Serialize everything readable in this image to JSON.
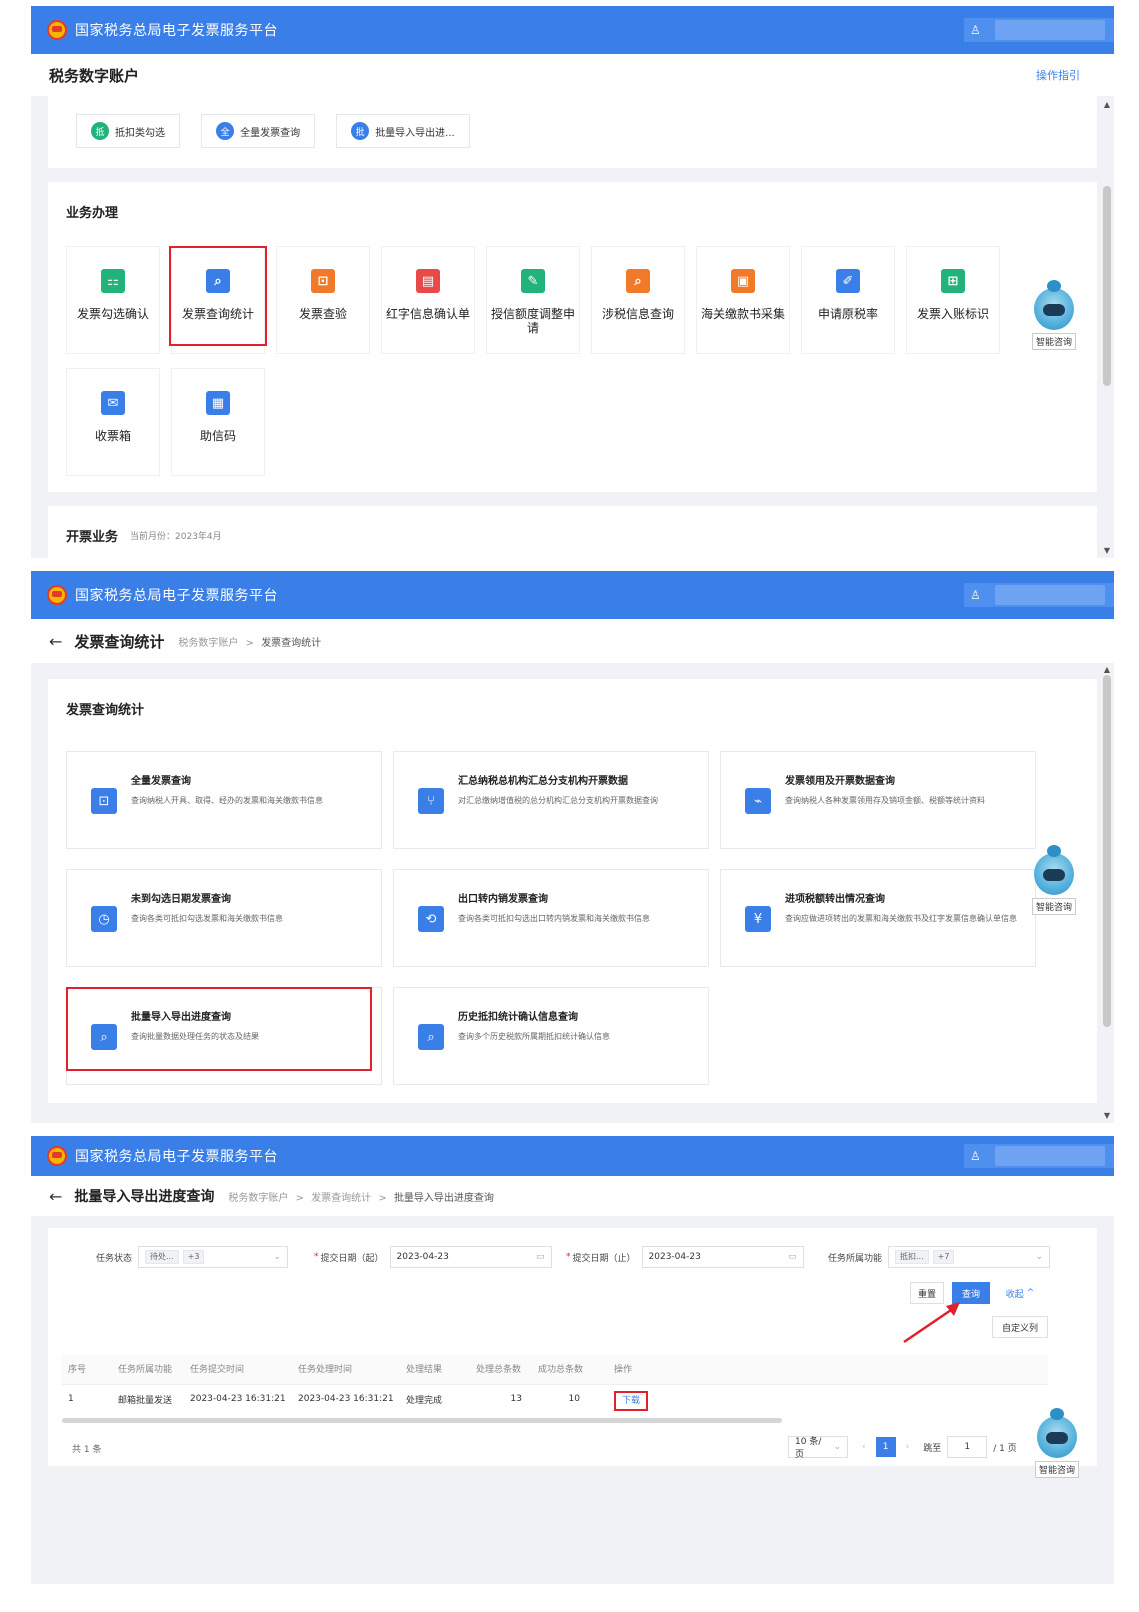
{
  "header": {
    "platform_title": "国家税务总局电子发票服务平台",
    "user_icon": "user-icon"
  },
  "screen1": {
    "page_title": "税务数字账户",
    "guide_link": "操作指引",
    "quick_links": [
      {
        "badge": "抵",
        "label": "抵扣类勾选",
        "color": "#22b37a"
      },
      {
        "badge": "全",
        "label": "全量发票查询",
        "color": "#3a7fe8"
      },
      {
        "badge": "批",
        "label": "批量导入导出进...",
        "color": "#3a7fe8"
      }
    ],
    "section_title": "业务办理",
    "tiles": [
      {
        "label": "发票勾选确认",
        "color": "#22b37a",
        "glyph": "⚏"
      },
      {
        "label": "发票查询统计",
        "color": "#3a7fe8",
        "glyph": "⌕"
      },
      {
        "label": "发票查验",
        "color": "#f07a2a",
        "glyph": "⊡"
      },
      {
        "label": "红字信息确认单",
        "color": "#e84a4a",
        "glyph": "▤"
      },
      {
        "label": "授信额度调整申请",
        "color": "#22b37a",
        "glyph": "✎"
      },
      {
        "label": "涉税信息查询",
        "color": "#f07a2a",
        "glyph": "⌕"
      },
      {
        "label": "海关缴款书采集",
        "color": "#f07a2a",
        "glyph": "▣"
      },
      {
        "label": "申请原税率",
        "color": "#3a7fe8",
        "glyph": "✐"
      },
      {
        "label": "发票入账标识",
        "color": "#22b37a",
        "glyph": "⊞"
      },
      {
        "label": "收票箱",
        "color": "#3a7fe8",
        "glyph": "✉"
      },
      {
        "label": "助信码",
        "color": "#3a7fe8",
        "glyph": "▦"
      }
    ],
    "billing_title": "开票业务",
    "billing_month": "当前月份：2023年4月",
    "assistant_label": "智能咨询"
  },
  "screen2": {
    "page_title": "发票查询统计",
    "breadcrumb_root": "税务数字账户",
    "breadcrumb_sep": ">",
    "breadcrumb_current": "发票查询统计",
    "section_title": "发票查询统计",
    "cards": [
      {
        "title": "全量发票查询",
        "desc": "查询纳税人开具、取得、经办的发票和海关缴款书信息",
        "glyph": "⊡"
      },
      {
        "title": "汇总纳税总机构汇总分支机构开票数据",
        "desc": "对汇总缴纳增值税的总分机构汇总分支机构开票数据查询",
        "glyph": "⑂"
      },
      {
        "title": "发票领用及开票数据查询",
        "desc": "查询纳税人各种发票领用存及销项金额、税额等统计资料",
        "glyph": "⌁"
      },
      {
        "title": "未到勾选日期发票查询",
        "desc": "查询各类可抵扣勾选发票和海关缴款书信息",
        "glyph": "◷"
      },
      {
        "title": "出口转内销发票查询",
        "desc": "查询各类可抵扣勾选出口转内销发票和海关缴款书信息",
        "glyph": "⟲"
      },
      {
        "title": "进项税额转出情况查询",
        "desc": "查询应做进项转出的发票和海关缴款书及红字发票信息确认单信息",
        "glyph": "¥"
      },
      {
        "title": "批量导入导出进度查询",
        "desc": "查询批量数据处理任务的状态及结果",
        "glyph": "⌕"
      },
      {
        "title": "历史抵扣统计确认信息查询",
        "desc": "查询多个历史税款所属期抵扣统计确认信息",
        "glyph": "⌕"
      }
    ],
    "assistant_label": "智能咨询"
  },
  "screen3": {
    "page_title": "批量导入导出进度查询",
    "breadcrumb": [
      "税务数字账户",
      "发票查询统计",
      "批量导入导出进度查询"
    ],
    "breadcrumb_sep": ">",
    "filters": {
      "status_label": "任务状态",
      "status_chip": "待处...",
      "status_more": "+3",
      "start_label": "提交日期（起）",
      "start_value": "2023-04-23",
      "end_label": "提交日期（止）",
      "end_value": "2023-04-23",
      "func_label": "任务所属功能",
      "func_chip": "抵扣...",
      "func_more": "+7"
    },
    "buttons": {
      "reset": "重置",
      "query": "查询",
      "collapse": "收起",
      "custom_columns": "自定义列"
    },
    "table": {
      "headers": [
        "序号",
        "任务所属功能",
        "任务提交时间",
        "任务处理时间",
        "处理结果",
        "处理总条数",
        "成功总条数",
        "操作"
      ],
      "rows": [
        [
          "1",
          "邮箱批量发送",
          "2023-04-23 16:31:21",
          "2023-04-23 16:31:21",
          "处理完成",
          "13",
          "10",
          "下载"
        ]
      ]
    },
    "pagination": {
      "total": "共 1 条",
      "page_size": "10 条/页",
      "current_page": "1",
      "jump_label": "跳至",
      "jump_value": "1",
      "page_suffix": "/ 1 页"
    },
    "assistant_label": "智能咨询"
  }
}
